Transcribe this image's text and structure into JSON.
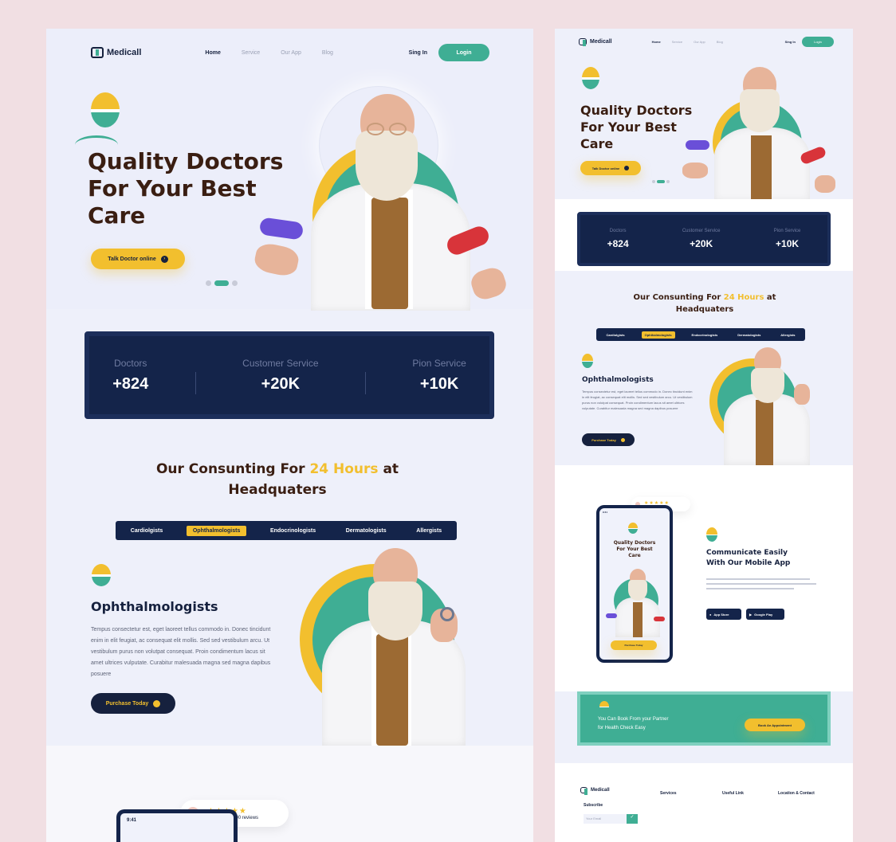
{
  "brand": "Medicall",
  "nav": {
    "items": [
      "Home",
      "Service",
      "Our App",
      "Blog"
    ],
    "sign_in": "Sing In",
    "login": "Login"
  },
  "hero": {
    "title_l1": "Quality Doctors",
    "title_l2": "For Your Best",
    "title_l3": "Care",
    "cta": "Talk Doctor online"
  },
  "stats": [
    {
      "label": "Doctors",
      "value": "+824"
    },
    {
      "label": "Customer Service",
      "value": "+20K"
    },
    {
      "label": "Pion Service",
      "value": "+10K"
    }
  ],
  "consulting": {
    "title_pre": "Our Consunting For ",
    "title_hl": "24 Hours",
    "title_post": " at",
    "title_l2": "Headquaters"
  },
  "tabs": [
    "Cardiolgists",
    "Ophthalmologists",
    "Endocrinologists",
    "Dermatologists",
    "Allergists"
  ],
  "active_tab": "Ophthalmologists",
  "specialty": {
    "title": "Ophthalmologists",
    "text": "Tempus consectetur est, eget laoreet tellus commodo in. Donec tincidunt enim in elit feugiat, ac consequat elit mollis. Sed sed vestibulum arcu. Ut vestibulum purus non volutpat consequat. Proin condimentum lacus sit amet ultrices vulputate. Curabitur malesuada magna sed magna dapibus posuere",
    "cta": "Purchase Today"
  },
  "reviews": {
    "stars": "★★★★★",
    "text": "Based on 1,400 reviews"
  },
  "phone": {
    "time": "9:41"
  },
  "mobile_app": {
    "title_l1": "Communicate Easily",
    "title_l2": "With Our Mobile App",
    "app_store": "App Store",
    "google_play": "Google Play"
  },
  "partner_cta": {
    "l1": "You Can Book From your Partner",
    "l2": "for Health  Check Easy",
    "button": "Book An Appointment"
  },
  "footer": {
    "subscribe": "Subscribe",
    "email_placeholder": "Your Email",
    "cols": [
      "Services",
      "Useful Link",
      "Location & Contact"
    ]
  },
  "colors": {
    "navy": "#14244a",
    "green": "#3fae94",
    "yellow": "#f2bf2e",
    "brown": "#3a1e12"
  }
}
